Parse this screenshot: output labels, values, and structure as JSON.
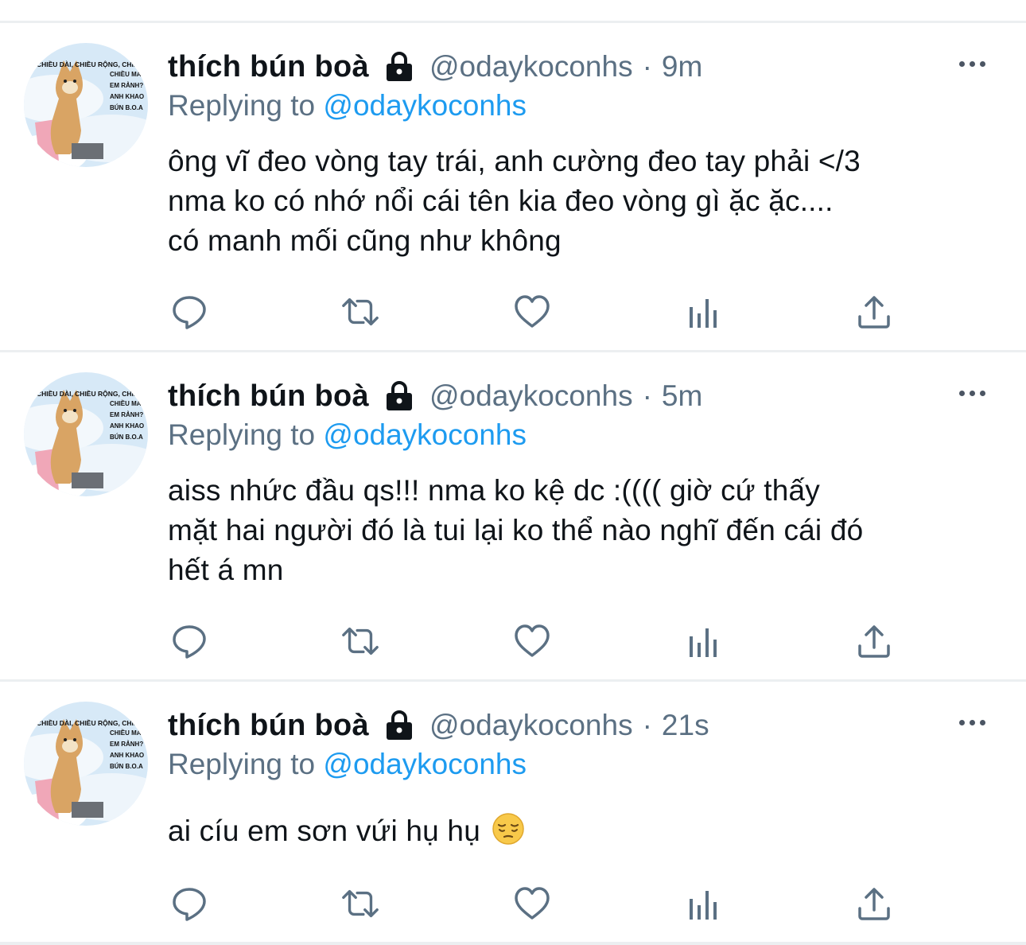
{
  "tweets": [
    {
      "display_name": "thích bún boà",
      "handle": "@odaykoconhs",
      "separator": "·",
      "time": "9m",
      "replying_prefix": "Replying to",
      "replying_to": "@odaykoconhs",
      "text_lines": [
        "ông vĩ đeo vòng tay trái, anh cường đeo tay phải </3",
        "nma ko có nhớ nổi cái tên kia đeo vòng gì ặc ặc....",
        "có manh mối cũng như không"
      ]
    },
    {
      "display_name": "thích bún boà",
      "handle": "@odaykoconhs",
      "separator": "·",
      "time": "5m",
      "replying_prefix": "Replying to",
      "replying_to": "@odaykoconhs",
      "text_lines": [
        "aiss nhức đầu qs!!! nma ko kệ dc :(((( giờ cứ thấy",
        "mặt hai người đó là tui lại ko thể nào nghĩ đến cái đó",
        "hết á mn"
      ]
    },
    {
      "display_name": "thích bún boà",
      "handle": "@odaykoconhs",
      "separator": "·",
      "time": "21s",
      "replying_prefix": "Replying to",
      "replying_to": "@odaykoconhs",
      "text_lines": [
        "ai cíu em sơn vứi hụ hụ"
      ],
      "emoji": "pensive-face"
    }
  ],
  "avatar_text": [
    "CHIỀU DÀI, CHIỀU RỘNG, CHIỀU",
    "CHIỀU MA",
    "EM RẢNH?",
    "ANH KHAO",
    "BÚN B.O.A"
  ],
  "icons": {
    "lock": "lock-icon",
    "more": "more-horizontal-icon",
    "reply": "reply-bubble-icon",
    "retweet": "retweet-icon",
    "like": "heart-icon",
    "analytics": "analytics-bars-icon",
    "share": "share-upload-icon"
  },
  "colors": {
    "mention": "#1d9bf0",
    "muted": "#5b7083",
    "text": "#0f1419",
    "divider": "#eceff1"
  }
}
